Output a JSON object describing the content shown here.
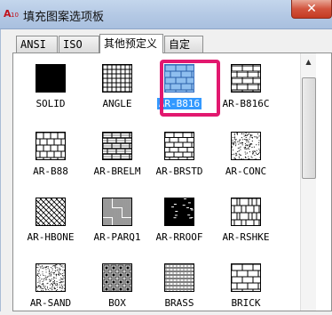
{
  "window": {
    "title": "填充图案选项板",
    "icon": "autocad-a10-icon",
    "close_icon": "close-icon"
  },
  "tabs": [
    {
      "label": "ANSI"
    },
    {
      "label": "ISO"
    },
    {
      "label": "其他预定义",
      "active": true
    },
    {
      "label": "自定义"
    }
  ],
  "patterns": [
    {
      "label": "SOLID"
    },
    {
      "label": "ANGLE"
    },
    {
      "label": "AR-B816",
      "selected": true
    },
    {
      "label": "AR-B816C"
    },
    {
      "label": "AR-B88"
    },
    {
      "label": "AR-BRELM"
    },
    {
      "label": "AR-BRSTD"
    },
    {
      "label": "AR-CONC"
    },
    {
      "label": "AR-HBONE"
    },
    {
      "label": "AR-PARQ1"
    },
    {
      "label": "AR-RROOF"
    },
    {
      "label": "AR-RSHKE"
    },
    {
      "label": "AR-SAND"
    },
    {
      "label": "BOX"
    },
    {
      "label": "BRASS"
    },
    {
      "label": "BRICK"
    }
  ],
  "colors": {
    "selection_highlight": "#3399ff",
    "annotation_box": "#e2186f",
    "selected_swatch_fill": "#8fbfef"
  }
}
